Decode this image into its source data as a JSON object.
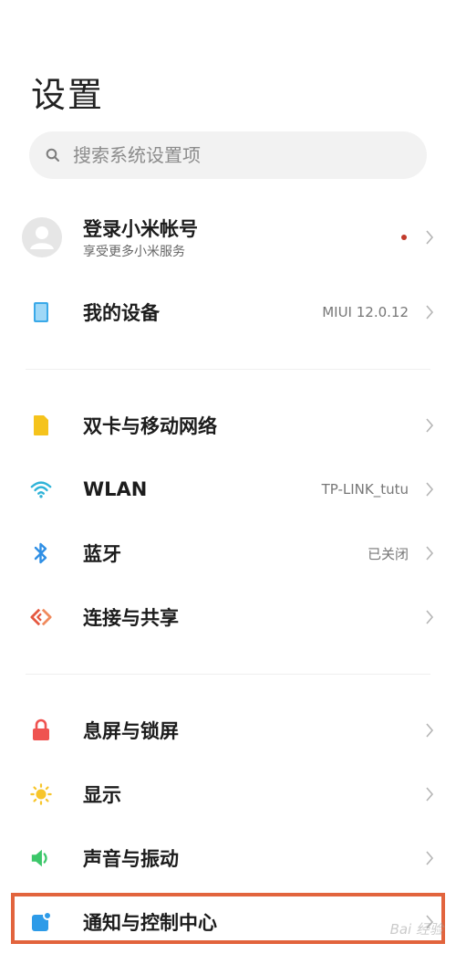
{
  "header": {
    "title": "设置"
  },
  "search": {
    "placeholder": "搜索系统设置项"
  },
  "account": {
    "title": "登录小米帐号",
    "subtitle": "享受更多小米服务"
  },
  "sections": [
    {
      "items": [
        {
          "key": "my-device",
          "label": "我的设备",
          "value": "MIUI 12.0.12",
          "icon": "device-icon",
          "icon_color": "#3aa9e8"
        }
      ]
    },
    {
      "items": [
        {
          "key": "sim",
          "label": "双卡与移动网络",
          "value": "",
          "icon": "sim-card-icon",
          "icon_color": "#f5c31c"
        },
        {
          "key": "wlan",
          "label": "WLAN",
          "value": "TP-LINK_tutu",
          "icon": "wifi-icon",
          "icon_color": "#2fb3d8"
        },
        {
          "key": "bluetooth",
          "label": "蓝牙",
          "value": "已关闭",
          "icon": "bluetooth-icon",
          "icon_color": "#2f8fe5"
        },
        {
          "key": "connection",
          "label": "连接与共享",
          "value": "",
          "icon": "share-connection-icon",
          "icon_color": "#e5573f"
        }
      ]
    },
    {
      "items": [
        {
          "key": "lock-screen",
          "label": "息屏与锁屏",
          "value": "",
          "icon": "lock-icon",
          "icon_color": "#ef5350"
        },
        {
          "key": "display",
          "label": "显示",
          "value": "",
          "icon": "sun-icon",
          "icon_color": "#f7c52b"
        },
        {
          "key": "sound",
          "label": "声音与振动",
          "value": "",
          "icon": "speaker-icon",
          "icon_color": "#3cc76a"
        },
        {
          "key": "notifications",
          "label": "通知与控制中心",
          "value": "",
          "icon": "notification-icon",
          "icon_color": "#2d9be8"
        }
      ]
    }
  ],
  "watermark": {
    "text": "Bai 经验"
  },
  "colors": {
    "highlight_frame": "#e2643d",
    "chevron": "#b5b5b5",
    "badge_dot": "#c23a2b"
  }
}
